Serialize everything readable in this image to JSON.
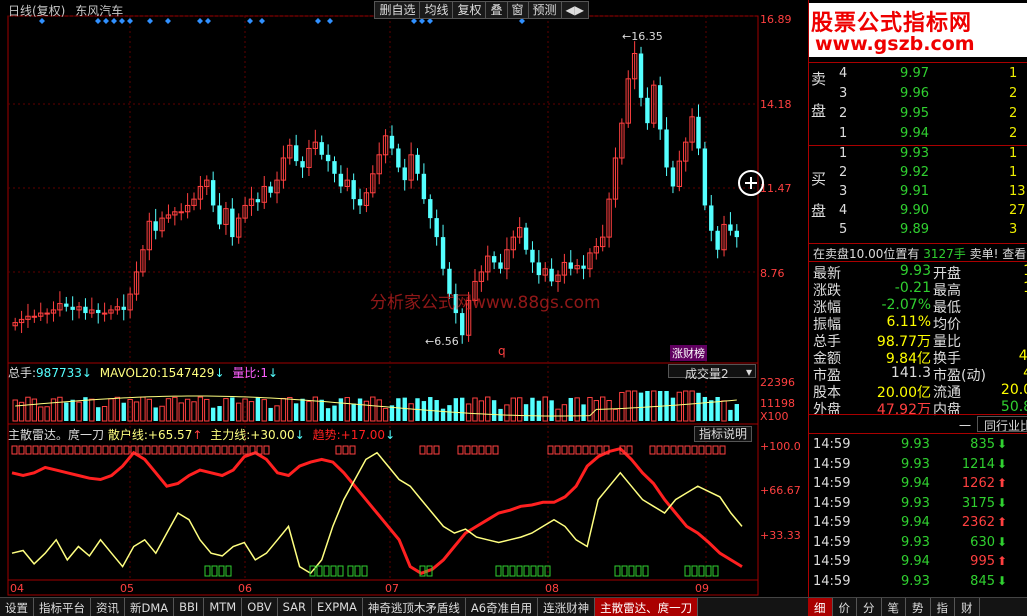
{
  "header": {
    "period": "日线(复权)",
    "stock_name": "东风汽车",
    "buttons": [
      "删自选",
      "均线",
      "复权",
      "叠",
      "窗",
      "预测",
      "◀▶"
    ]
  },
  "price_axis": {
    "labels": [
      "16.89",
      "14.18",
      "11.47",
      "8.76"
    ]
  },
  "annotations": {
    "high": "16.35",
    "low": "6.56",
    "q_mark": "q",
    "news_badge": "涨财榜",
    "watermark": "分析家公式网www.88gs.com"
  },
  "volume_panel": {
    "title": "总手:",
    "value": "987733",
    "mavol_label": "MAVOL20:",
    "mavol_value": "1547429",
    "ratio_label": "量比:",
    "ratio_value": "1",
    "dropdown": "成交量2",
    "axis": [
      "22396",
      "11198",
      "X100"
    ]
  },
  "indicator_panel": {
    "name": "主散雷达",
    "subtitle": "庹一刀",
    "retail_label": "散户线:",
    "retail_value": "+65.57",
    "main_label": "主力线:",
    "main_value": "+30.00",
    "trend_label": "趋势",
    "trend_value": "+17.00",
    "help_button": "指标说明",
    "axis": [
      "+100.0",
      "+66.67",
      "+33.33"
    ]
  },
  "x_axis": [
    "04",
    "05",
    "06",
    "07",
    "08",
    "09"
  ],
  "banner": {
    "line1": "股票公式指标网",
    "line2": "www.gszb.com"
  },
  "order_book": {
    "sell_label": [
      "卖",
      "盘"
    ],
    "buy_label": [
      "买",
      "盘"
    ],
    "asks": [
      {
        "level": "4",
        "price": "9.97",
        "vol": "1"
      },
      {
        "level": "3",
        "price": "9.96",
        "vol": "2"
      },
      {
        "level": "2",
        "price": "9.95",
        "vol": "2"
      },
      {
        "level": "1",
        "price": "9.94",
        "vol": "2"
      }
    ],
    "bids": [
      {
        "level": "1",
        "price": "9.93",
        "vol": "1"
      },
      {
        "level": "2",
        "price": "9.92",
        "vol": "1"
      },
      {
        "level": "3",
        "price": "9.91",
        "vol": "13"
      },
      {
        "level": "4",
        "price": "9.90",
        "vol": "27"
      },
      {
        "level": "5",
        "price": "9.89",
        "vol": "3"
      }
    ],
    "notice": "在卖盘10.00位置有",
    "notice_vol": "3127手",
    "notice_tail": "卖单! 查看"
  },
  "stats": [
    {
      "k": "最新",
      "v": "9.93",
      "k2": "开盘",
      "v2": "10"
    },
    {
      "k": "涨跌",
      "v": "-0.21",
      "k2": "最高",
      "v2": "10"
    },
    {
      "k": "涨幅",
      "v": "-2.07%",
      "k2": "最低",
      "v2": "9"
    },
    {
      "k": "振幅",
      "v": "6.11%",
      "k2": "均价",
      "v2": "9"
    },
    {
      "k": "总手",
      "v": "98.77万",
      "k2": "量比",
      "v2": "0"
    },
    {
      "k": "金额",
      "v": "9.84亿",
      "k2": "换手",
      "v2": "4.9"
    },
    {
      "k": "市盈",
      "v": "141.3",
      "k2": "市盈(动)",
      "v2": "42"
    },
    {
      "k": "股本",
      "v": "20.00亿",
      "k2": "流通",
      "v2": "20.00"
    },
    {
      "k": "外盘",
      "v": "47.92万",
      "k2": "内盘",
      "v2": "50.86"
    }
  ],
  "tabs_mid": [
    "一",
    "同行业比较"
  ],
  "ticks": [
    {
      "time": "14:59",
      "price": "9.93",
      "vol": "835",
      "dir": "down"
    },
    {
      "time": "14:59",
      "price": "9.93",
      "vol": "1214",
      "dir": "down"
    },
    {
      "time": "14:59",
      "price": "9.94",
      "vol": "1262",
      "dir": "up"
    },
    {
      "time": "14:59",
      "price": "9.93",
      "vol": "3175",
      "dir": "down"
    },
    {
      "time": "14:59",
      "price": "9.94",
      "vol": "2362",
      "dir": "up"
    },
    {
      "time": "14:59",
      "price": "9.93",
      "vol": "630",
      "dir": "down"
    },
    {
      "time": "14:59",
      "price": "9.94",
      "vol": "995",
      "dir": "up"
    },
    {
      "time": "14:59",
      "price": "9.93",
      "vol": "845",
      "dir": "down"
    }
  ],
  "bottom_tabs": [
    "设置",
    "指标平台",
    "资讯",
    "新DMA",
    "BBI",
    "MTM",
    "OBV",
    "SAR",
    "EXPMA",
    "神奇逃顶木矛盾线",
    "A6奇准自用",
    "连涨财神",
    "主散雷达、庹一刀"
  ],
  "right_tabs": [
    "细",
    "价",
    "分",
    "笔",
    "势",
    "指",
    "财"
  ],
  "colors": {
    "up": "#ff4040",
    "down": "#54ffff",
    "grid": "#a00000",
    "retail_line": "#ffff80",
    "main_line": "#ff2020",
    "green": "#30d030"
  }
}
